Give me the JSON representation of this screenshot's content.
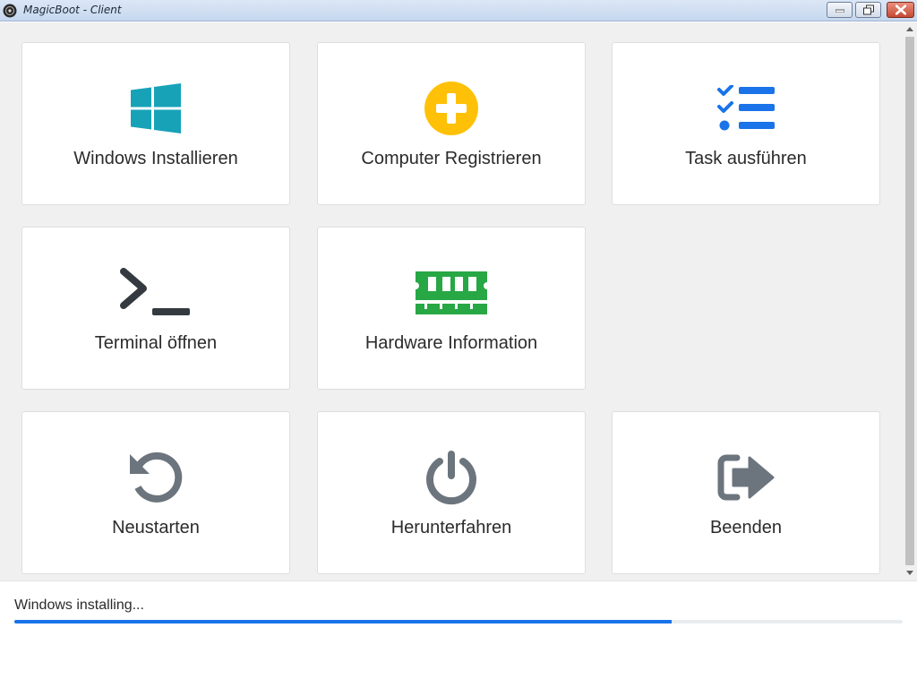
{
  "window": {
    "title": "MagicBoot - Client"
  },
  "cards": [
    {
      "id": "windows-installieren",
      "label": "Windows Installieren",
      "icon": "windows-logo-icon",
      "color": "#17a2b8"
    },
    {
      "id": "computer-registrieren",
      "label": "Computer Registrieren",
      "icon": "plus-circle-icon",
      "color": "#ffc107"
    },
    {
      "id": "task-ausfuehren",
      "label": "Task ausführen",
      "icon": "tasks-icon",
      "color": "#1a73e8"
    },
    {
      "id": "terminal-oeffnen",
      "label": "Terminal öffnen",
      "icon": "terminal-icon",
      "color": "#343a40"
    },
    {
      "id": "hardware-information",
      "label": "Hardware Information",
      "icon": "memory-icon",
      "color": "#28a745"
    },
    {
      "id": "neustarten",
      "label": "Neustarten",
      "icon": "restart-icon",
      "color": "#6c757d"
    },
    {
      "id": "herunterfahren",
      "label": "Herunterfahren",
      "icon": "power-icon",
      "color": "#6c757d"
    },
    {
      "id": "beenden",
      "label": "Beenden",
      "icon": "sign-out-icon",
      "color": "#6c757d"
    }
  ],
  "status": {
    "text": "Windows installing...",
    "progress_percent": 74
  }
}
